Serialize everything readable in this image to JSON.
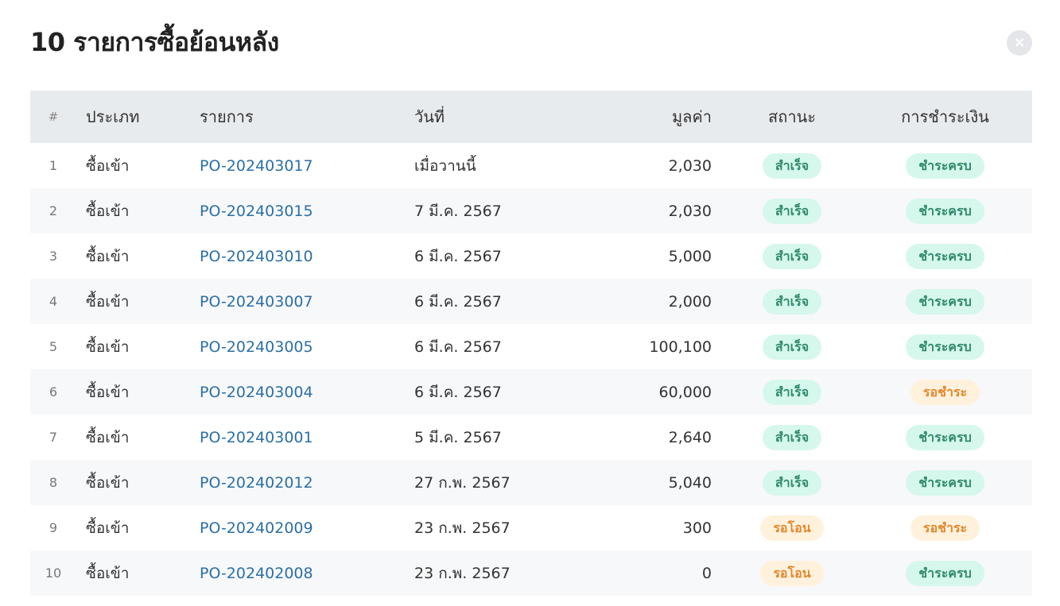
{
  "modal": {
    "title": "10 รายการซื้อย้อนหลัง",
    "close_icon": "×"
  },
  "table": {
    "headers": {
      "num": "#",
      "type": "ประเภท",
      "ref": "รายการ",
      "date": "วันที่",
      "value": "มูลค่า",
      "status": "สถานะ",
      "payment": "การชำระเงิน"
    },
    "rows": [
      {
        "num": "1",
        "type": "ซื้อเข้า",
        "ref": "PO-202403017",
        "date": "เมื่อวานนี้",
        "value": "2,030",
        "status": "สำเร็จ",
        "status_tone": "green",
        "payment": "ชำระครบ",
        "payment_tone": "green"
      },
      {
        "num": "2",
        "type": "ซื้อเข้า",
        "ref": "PO-202403015",
        "date": "7 มี.ค. 2567",
        "value": "2,030",
        "status": "สำเร็จ",
        "status_tone": "green",
        "payment": "ชำระครบ",
        "payment_tone": "green"
      },
      {
        "num": "3",
        "type": "ซื้อเข้า",
        "ref": "PO-202403010",
        "date": "6 มี.ค. 2567",
        "value": "5,000",
        "status": "สำเร็จ",
        "status_tone": "green",
        "payment": "ชำระครบ",
        "payment_tone": "green"
      },
      {
        "num": "4",
        "type": "ซื้อเข้า",
        "ref": "PO-202403007",
        "date": "6 มี.ค. 2567",
        "value": "2,000",
        "status": "สำเร็จ",
        "status_tone": "green",
        "payment": "ชำระครบ",
        "payment_tone": "green"
      },
      {
        "num": "5",
        "type": "ซื้อเข้า",
        "ref": "PO-202403005",
        "date": "6 มี.ค. 2567",
        "value": "100,100",
        "status": "สำเร็จ",
        "status_tone": "green",
        "payment": "ชำระครบ",
        "payment_tone": "green"
      },
      {
        "num": "6",
        "type": "ซื้อเข้า",
        "ref": "PO-202403004",
        "date": "6 มี.ค. 2567",
        "value": "60,000",
        "status": "สำเร็จ",
        "status_tone": "green",
        "payment": "รอชำระ",
        "payment_tone": "orange"
      },
      {
        "num": "7",
        "type": "ซื้อเข้า",
        "ref": "PO-202403001",
        "date": "5 มี.ค. 2567",
        "value": "2,640",
        "status": "สำเร็จ",
        "status_tone": "green",
        "payment": "ชำระครบ",
        "payment_tone": "green"
      },
      {
        "num": "8",
        "type": "ซื้อเข้า",
        "ref": "PO-202402012",
        "date": "27 ก.พ. 2567",
        "value": "5,040",
        "status": "สำเร็จ",
        "status_tone": "green",
        "payment": "ชำระครบ",
        "payment_tone": "green"
      },
      {
        "num": "9",
        "type": "ซื้อเข้า",
        "ref": "PO-202402009",
        "date": "23 ก.พ. 2567",
        "value": "300",
        "status": "รอโอน",
        "status_tone": "orange",
        "payment": "รอชำระ",
        "payment_tone": "orange"
      },
      {
        "num": "10",
        "type": "ซื้อเข้า",
        "ref": "PO-202402008",
        "date": "23 ก.พ. 2567",
        "value": "0",
        "status": "รอโอน",
        "status_tone": "orange",
        "payment": "ชำระครบ",
        "payment_tone": "green"
      }
    ]
  },
  "colors": {
    "link": "#2b6fa6",
    "success_bg": "#d6f8ec",
    "success_text": "#2f8a6a",
    "pending_bg": "#fff1dc",
    "pending_text": "#e2872c",
    "header_bg": "#e8ebee"
  }
}
